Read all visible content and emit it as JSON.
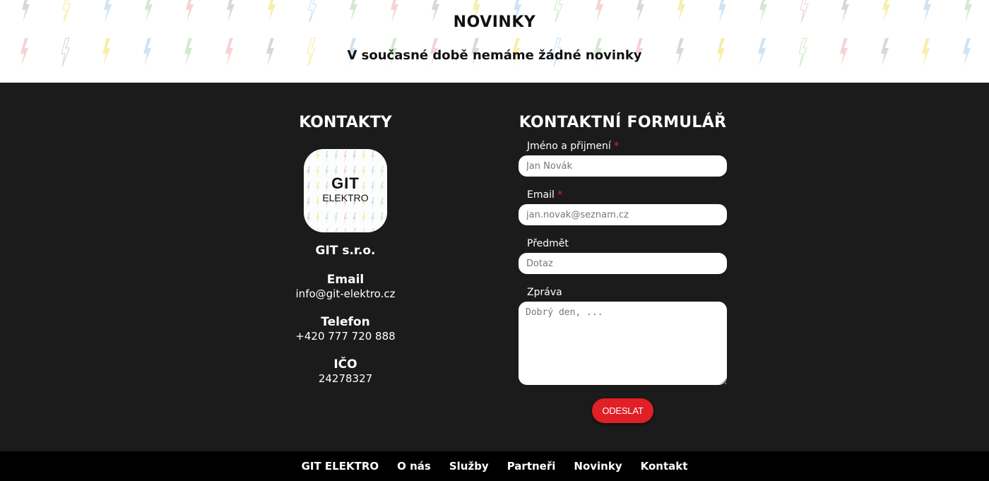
{
  "news": {
    "title": "NOVINKY",
    "message": "V současné době nemáme žádné novinky"
  },
  "contacts": {
    "title": "KONTAKTY",
    "logo": {
      "line1": "GIT",
      "line2": "ELEKTRO"
    },
    "company": "GIT s.r.o.",
    "email_label": "Email",
    "email_value": "info@git-elektro.cz",
    "phone_label": "Telefon",
    "phone_value": "+420 777 720 888",
    "ico_label": "IČO",
    "ico_value": "24278327"
  },
  "form": {
    "title": "KONTAKTNÍ FORMULÁŘ",
    "name_label": "Jméno a přijmení",
    "name_placeholder": "Jan Novák",
    "email_label": "Email",
    "email_placeholder": "jan.novak@seznam.cz",
    "subject_label": "Předmět",
    "subject_placeholder": "Dotaz",
    "message_label": "Zpráva",
    "message_placeholder": "Dobrý den, ...",
    "required_mark": "*",
    "submit_label": "ODESLAT"
  },
  "footer": {
    "items": [
      "GIT ELEKTRO",
      "O nás",
      "Služby",
      "Partneři",
      "Novinky",
      "Kontakt"
    ]
  },
  "colors": {
    "accent_red": "#e01f26",
    "dark_bg": "#1b1b1b",
    "footer_bg": "#000000",
    "bolt_colors": [
      "#d8d8d8",
      "#f7eeaa",
      "#cfe3f4",
      "#d4ead0",
      "#f6d3d5"
    ]
  }
}
